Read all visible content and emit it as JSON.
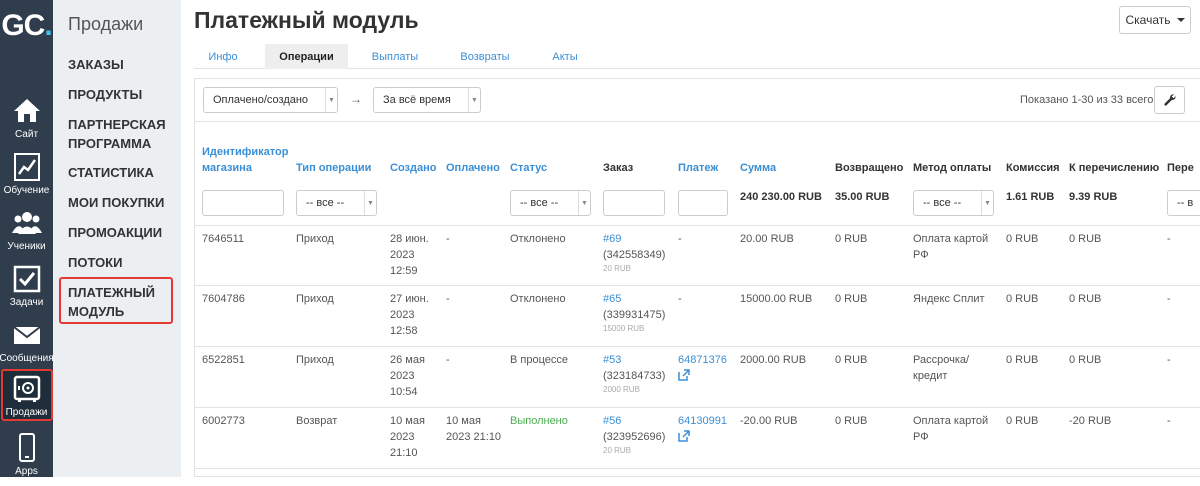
{
  "rail": {
    "logo": "GC",
    "logo_dot": ".",
    "items": [
      {
        "label": "Сайт",
        "icon": "house-icon"
      },
      {
        "label": "Обучение",
        "icon": "chart-icon"
      },
      {
        "label": "Ученики",
        "icon": "users-icon"
      },
      {
        "label": "Задачи",
        "icon": "checkbox-icon"
      },
      {
        "label": "Сообщения",
        "icon": "envelope-icon"
      },
      {
        "label": "Продажи",
        "icon": "safe-icon"
      },
      {
        "label": "Apps",
        "icon": "phone-icon"
      }
    ]
  },
  "sidebar": {
    "title": "Продажи",
    "items": [
      {
        "label": "ЗАКАЗЫ"
      },
      {
        "label": "ПРОДУКТЫ"
      },
      {
        "label": "ПАРТНЕРСКАЯ ПРОГРАММА"
      },
      {
        "label": "СТАТИСТИКА"
      },
      {
        "label": "МОИ ПОКУПКИ"
      },
      {
        "label": "ПРОМОАКЦИИ"
      },
      {
        "label": "ПОТОКИ"
      },
      {
        "label": "ПЛАТЕЖНЫЙ МОДУЛЬ"
      }
    ]
  },
  "header": {
    "title": "Платежный модуль",
    "download_label": "Скачать"
  },
  "tabs": [
    {
      "label": "Инфо"
    },
    {
      "label": "Операции"
    },
    {
      "label": "Выплаты"
    },
    {
      "label": "Возвраты"
    },
    {
      "label": "Акты"
    }
  ],
  "filters": {
    "date_type": "Оплачено/создано",
    "arrow": "→",
    "period": "За всё время",
    "shown": "Показано 1-30 из 33 всего."
  },
  "table": {
    "headers": {
      "store_id": "Идентификатор магазина",
      "op_type": "Тип операции",
      "created": "Создано",
      "paid": "Оплачено",
      "status": "Статус",
      "order": "Заказ",
      "payment": "Платеж",
      "sum": "Сумма",
      "refunded": "Возвращено",
      "method": "Метод оплаты",
      "commission": "Комиссия",
      "transfer": "К перечислению",
      "next": "Пере"
    },
    "filters": {
      "op_type": "-- все --",
      "status": "-- все --",
      "method": "-- все --",
      "next": "-- в"
    },
    "totals": {
      "sum": "240 230.00 RUB",
      "refunded": "35.00 RUB",
      "commission": "1.61 RUB",
      "transfer": "9.39 RUB"
    },
    "rows": [
      {
        "store_id": "7646511",
        "op_type": "Приход",
        "created": "28 июн. 2023 12:59",
        "paid": "-",
        "status": "Отклонено",
        "order": "#69",
        "order_id": "(342558349)",
        "order_sum": "20 RUB",
        "payment": "-",
        "sum": "20.00 RUB",
        "refunded": "0 RUB",
        "method": "Оплата картой РФ",
        "commission": "0 RUB",
        "transfer": "0 RUB",
        "next": "-"
      },
      {
        "store_id": "7604786",
        "op_type": "Приход",
        "created": "27 июн. 2023 12:58",
        "paid": "-",
        "status": "Отклонено",
        "order": "#65",
        "order_id": "(339931475)",
        "order_sum": "15000 RUB",
        "payment": "-",
        "sum": "15000.00 RUB",
        "refunded": "0 RUB",
        "method": "Яндекс Сплит",
        "commission": "0 RUB",
        "transfer": "0 RUB",
        "next": "-"
      },
      {
        "store_id": "6522851",
        "op_type": "Приход",
        "created": "26 мая 2023 10:54",
        "paid": "-",
        "status": "В процессе",
        "order": "#53",
        "order_id": "(323184733)",
        "order_sum": "2000 RUB",
        "payment": "64871376",
        "sum": "2000.00 RUB",
        "refunded": "0 RUB",
        "method": "Рассрочка/ кредит",
        "commission": "0 RUB",
        "transfer": "0 RUB",
        "next": "-"
      },
      {
        "store_id": "6002773",
        "op_type": "Возврат",
        "created": "10 мая 2023 21:10",
        "paid": "10 мая 2023 21:10",
        "status": "Выполнено",
        "order": "#56",
        "order_id": "(323952696)",
        "order_sum": "20 RUB",
        "payment": "64130991",
        "sum": "-20.00 RUB",
        "refunded": "0 RUB",
        "method": "Оплата картой РФ",
        "commission": "0 RUB",
        "transfer": "-20 RUB",
        "next": "-"
      }
    ]
  },
  "colors": {
    "rail_bg": "#2f3d4c",
    "sidebar_bg": "#eceff1",
    "link": "#3a8fd6",
    "highlight": "#e53935",
    "success": "#4caf50"
  }
}
